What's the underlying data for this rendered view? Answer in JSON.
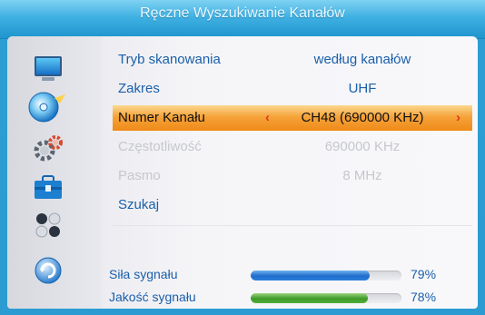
{
  "title": "Ręczne Wyszukiwanie Kanałów",
  "sidebar": {
    "icons": [
      "monitor-icon",
      "disc-icon",
      "gear-icon",
      "toolbox-icon",
      "dots-icon",
      "refresh-icon"
    ]
  },
  "settings": [
    {
      "label": "Tryb skanowania",
      "value": "według kanałów",
      "state": "active"
    },
    {
      "label": "Zakres",
      "value": "UHF",
      "state": "active"
    },
    {
      "label": "Numer Kanału",
      "value": "CH48 (690000 KHz)",
      "state": "selected"
    },
    {
      "label": "Częstotliwość",
      "value": "690000 KHz",
      "state": "disabled"
    },
    {
      "label": "Pasmo",
      "value": "8 MHz",
      "state": "disabled"
    },
    {
      "label": "Szukaj",
      "value": "",
      "state": "active"
    }
  ],
  "signal": {
    "strength": {
      "label": "Siła sygnału",
      "percent_text": "79%",
      "value": 0.79,
      "color": "#2a78d6"
    },
    "quality": {
      "label": "Jakość sygnału",
      "percent_text": "78%",
      "value": 0.78,
      "color": "#4aa833"
    }
  },
  "colors": {
    "title_bar": "#2b9bd1",
    "selected_row": "#f5a33a",
    "arrow": "#e0361c",
    "label_text": "#1a5faa",
    "disabled_text": "#c6c8cc"
  }
}
